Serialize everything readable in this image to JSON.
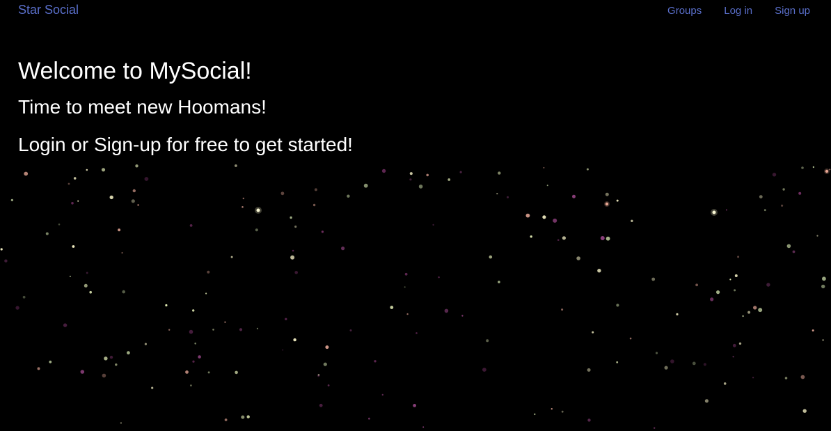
{
  "navbar": {
    "brand": "Star Social",
    "links": [
      {
        "label": "Groups"
      },
      {
        "label": "Log in"
      },
      {
        "label": "Sign up"
      }
    ]
  },
  "hero": {
    "title": "Welcome to MySocial!",
    "subtitle": "Time to meet new Hoomans!",
    "cta_text": "Login or Sign-up for free to get started!"
  },
  "theme": {
    "background": "#000000",
    "link_color": "#5a6fcb",
    "text_color": "#ffffff",
    "star_colors": [
      "#e6f0b8",
      "#d39a8a",
      "#8a3f7a",
      "#a7b58a",
      "#f3efc3",
      "#6e2d5f"
    ]
  }
}
